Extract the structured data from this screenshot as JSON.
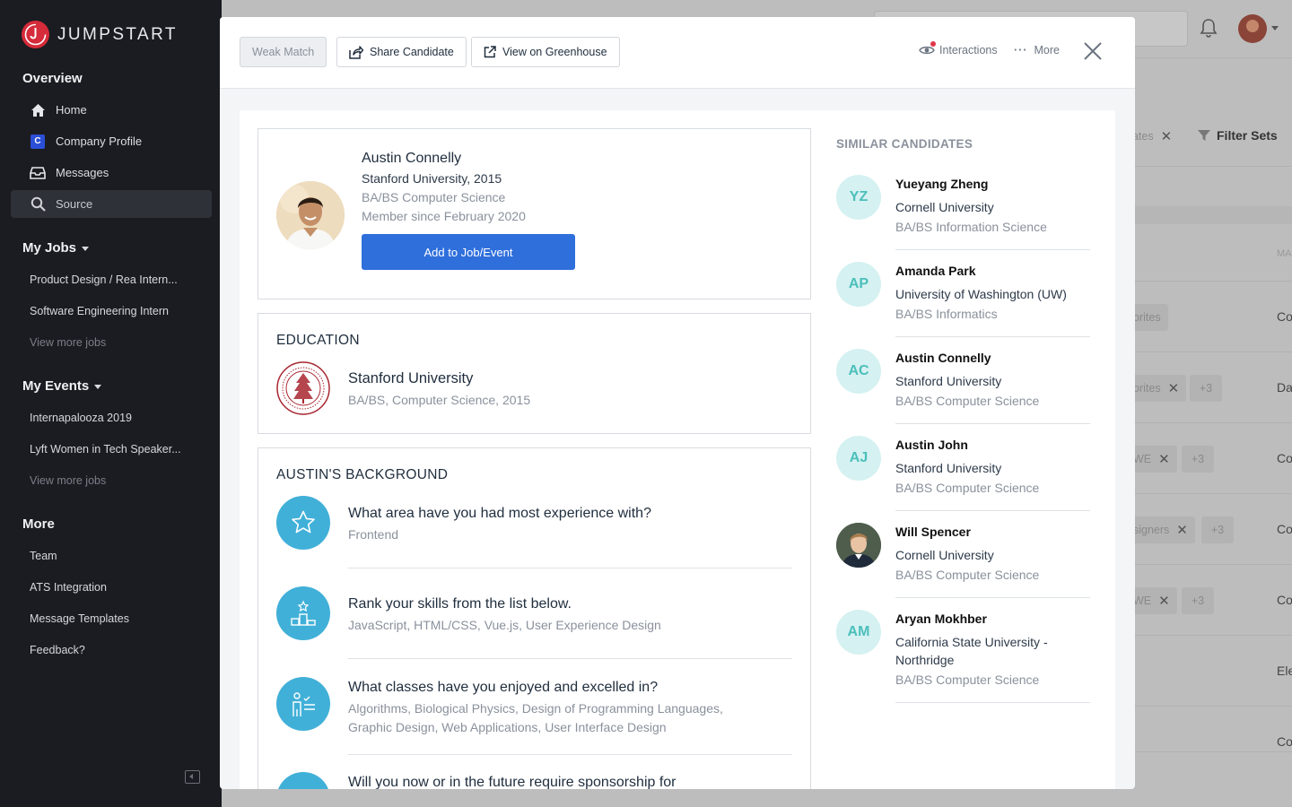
{
  "brand": {
    "name": "JUMPSTART"
  },
  "sidebar": {
    "overview_title": "Overview",
    "nav": [
      {
        "label": "Home"
      },
      {
        "label": "Company Profile",
        "icon_letter": "C"
      },
      {
        "label": "Messages"
      },
      {
        "label": "Source"
      }
    ],
    "jobs_title": "My Jobs",
    "jobs": [
      "Product Design / Rea Intern...",
      "Software Engineering Intern"
    ],
    "jobs_more": "View more jobs",
    "events_title": "My Events",
    "events": [
      "Internapalooza 2019",
      "Lyft Women in Tech Speaker..."
    ],
    "events_more": "View more jobs",
    "more_title": "More",
    "more_items": [
      "Team",
      "ATS Integration",
      "Message Templates",
      "Feedback?"
    ]
  },
  "background": {
    "chip_truncated": "uates",
    "filter_sets": "Filter Sets",
    "col_head": "MA",
    "rows": [
      {
        "chip": "orites",
        "col": "Co"
      },
      {
        "chip": "orites",
        "plus": "+3",
        "col": "Da"
      },
      {
        "chip": "WE",
        "plus": "+3",
        "col": "Co"
      },
      {
        "chip": "signers",
        "plus": "+3",
        "col": "Co"
      },
      {
        "chip": "WE",
        "plus": "+3",
        "col": "Co"
      },
      {
        "col": "Ele"
      },
      {
        "col": "Co"
      }
    ]
  },
  "modal": {
    "header": {
      "weak_match": "Weak Match",
      "share": "Share Candidate",
      "greenhouse": "View on Greenhouse",
      "interactions": "Interactions",
      "more": "More"
    },
    "profile": {
      "name": "Austin Connelly",
      "school": "Stanford University, 2015",
      "degree": "BA/BS Computer Science",
      "member_since": "Member since February 2020",
      "add_button": "Add to Job/Event"
    },
    "education": {
      "title": "EDUCATION",
      "school": "Stanford University",
      "detail": "BA/BS, Computer Science, 2015"
    },
    "background": {
      "title": "AUSTIN'S BACKGROUND",
      "questions": [
        {
          "q": "What area have you had most experience with?",
          "a": "Frontend",
          "icon": "star-icon"
        },
        {
          "q": "Rank your skills from the list below.",
          "a": "JavaScript, HTML/CSS, Vue.js, User Experience Design",
          "icon": "ranking-podium-icon"
        },
        {
          "q": "What classes have you enjoyed and excelled in?",
          "a": "Algorithms, Biological Physics, Design of Programming Languages, Graphic Design, Web Applications, User Interface Design",
          "icon": "teacher-board-icon"
        },
        {
          "q": "Will you now or in the future require sponsorship for",
          "a": "",
          "icon": "sponsorship-icon"
        }
      ]
    },
    "similar": {
      "title": "SIMILAR CANDIDATES",
      "items": [
        {
          "initials": "YZ",
          "name": "Yueyang Zheng",
          "school": "Cornell University",
          "degree": "BA/BS Information Science"
        },
        {
          "initials": "AP",
          "name": "Amanda Park",
          "school": "University of Washington (UW)",
          "degree": "BA/BS Informatics"
        },
        {
          "initials": "AC",
          "name": "Austin Connelly",
          "school": "Stanford University",
          "degree": "BA/BS Computer Science"
        },
        {
          "initials": "AJ",
          "name": "Austin John",
          "school": "Stanford University",
          "degree": "BA/BS Computer Science"
        },
        {
          "initials": "",
          "name": "Will Spencer",
          "school": "Cornell University",
          "degree": "BA/BS Computer Science"
        },
        {
          "initials": "AM",
          "name": "Aryan Mokhber",
          "school": "California State University - Northridge",
          "degree": "BA/BS Computer Science"
        }
      ]
    }
  }
}
